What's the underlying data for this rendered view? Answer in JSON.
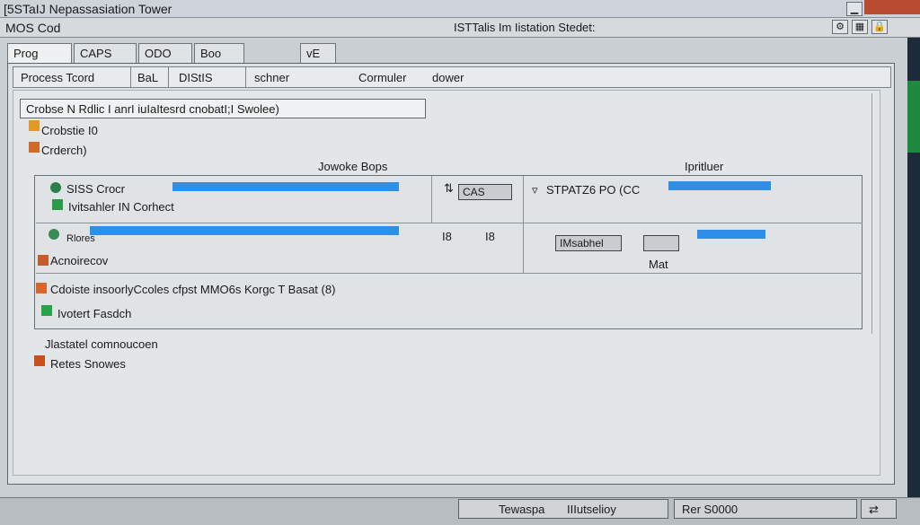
{
  "title": "[5STaIJ Nepassasiation Tower",
  "menu": {
    "left": "MOS Cod",
    "center": "ISTTalis Im Iistation Stedet:",
    "icons": [
      "gear-icon",
      "grid-icon",
      "lock-icon"
    ]
  },
  "tabs": [
    {
      "label": "Prog"
    },
    {
      "label": "CAPS"
    },
    {
      "label": "ODO"
    },
    {
      "label": "Boo"
    },
    {
      "label": "vE"
    }
  ],
  "subbar": {
    "items": [
      "Process Tcord",
      "BaL",
      "DIStIS",
      "schner",
      "Cormuler",
      "dower"
    ]
  },
  "input_value": "Crobse N Rdlic  I anrI iuIaItesrd cnobatI;I Swolee)",
  "labels": {
    "l1": "Crobstie  I0",
    "l2": "Crderch)",
    "col1": "Jowoke Bops",
    "col2": "Ipritluer"
  },
  "group": {
    "r1": "SISS Crocr",
    "r2": "Ivitsahler IN Corhect",
    "r3": "Rlores",
    "r4": "Acnoirecov",
    "r5": "Cdoiste insoorlyCcoles cfpst MMO6s Korgc T Basat (8)",
    "r6": "Ivotert Fasdch",
    "box1": "CAS",
    "box2": "IMsabhel",
    "box3": "Mat",
    "right1": "STPATZ6 PO  (CC",
    "mid": "I8",
    "mid2": "I8"
  },
  "after": {
    "a1": "Jlastatel comnoucoen",
    "a2": "Retes Snowes"
  },
  "status": {
    "s1": "Tewaspa",
    "s2": "IIIutselioy",
    "s3": "Rer S0000"
  }
}
